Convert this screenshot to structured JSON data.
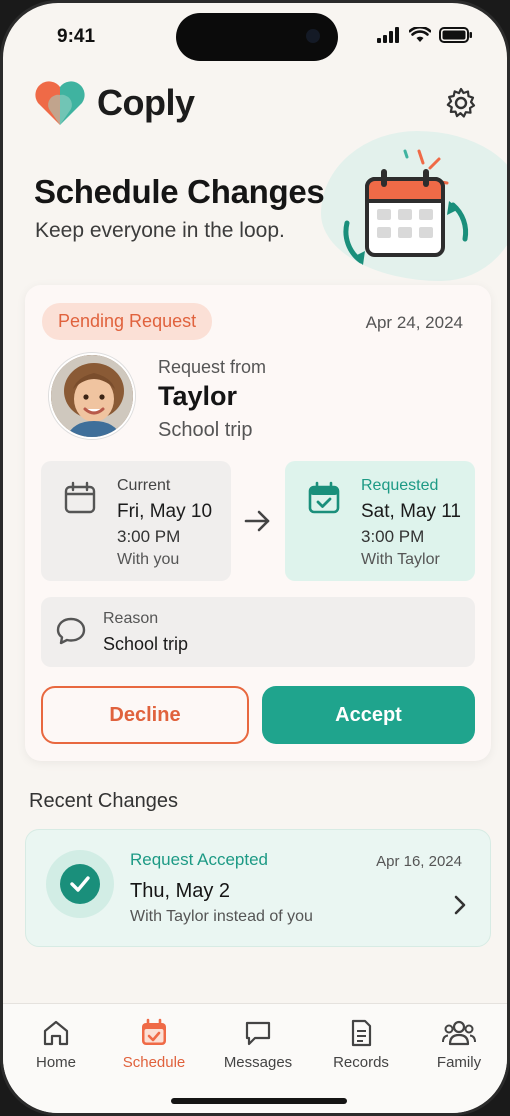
{
  "status_bar": {
    "time": "9:41"
  },
  "app": {
    "name": "Coply",
    "brand_colors": {
      "orange": "#ef6a47",
      "teal": "#3fb3a0"
    }
  },
  "header": {
    "settings_icon": "gear-icon"
  },
  "hero": {
    "title": "Schedule Changes",
    "subtitle": "Keep everyone in the loop."
  },
  "request": {
    "status": "Pending Request",
    "date": "Apr 24, 2024",
    "from_label": "Request from",
    "name": "Taylor",
    "topic": "School trip",
    "current": {
      "label": "Current",
      "day": "Fri, May 10",
      "time": "3:00 PM",
      "with": "With you"
    },
    "requested": {
      "label": "Requested",
      "day": "Sat, May 11",
      "time": "3:00 PM",
      "with": "With Taylor"
    },
    "reason_label": "Reason",
    "reason_text": "School trip",
    "decline_label": "Decline",
    "accept_label": "Accept"
  },
  "recent": {
    "title": "Recent Changes",
    "items": [
      {
        "status": "Request Accepted",
        "date": "Apr 16, 2024",
        "day": "Thu, May 2",
        "detail": "With Taylor instead of you"
      }
    ]
  },
  "tabs": [
    {
      "label": "Home",
      "icon": "home-icon",
      "active": false
    },
    {
      "label": "Schedule",
      "icon": "calendar-icon",
      "active": true
    },
    {
      "label": "Messages",
      "icon": "message-icon",
      "active": false
    },
    {
      "label": "Records",
      "icon": "document-icon",
      "active": false
    },
    {
      "label": "Family",
      "icon": "people-icon",
      "active": false
    }
  ],
  "colors": {
    "accent_orange": "#e0623d",
    "accent_teal": "#1fa48d",
    "background": "#f8f5f1"
  }
}
